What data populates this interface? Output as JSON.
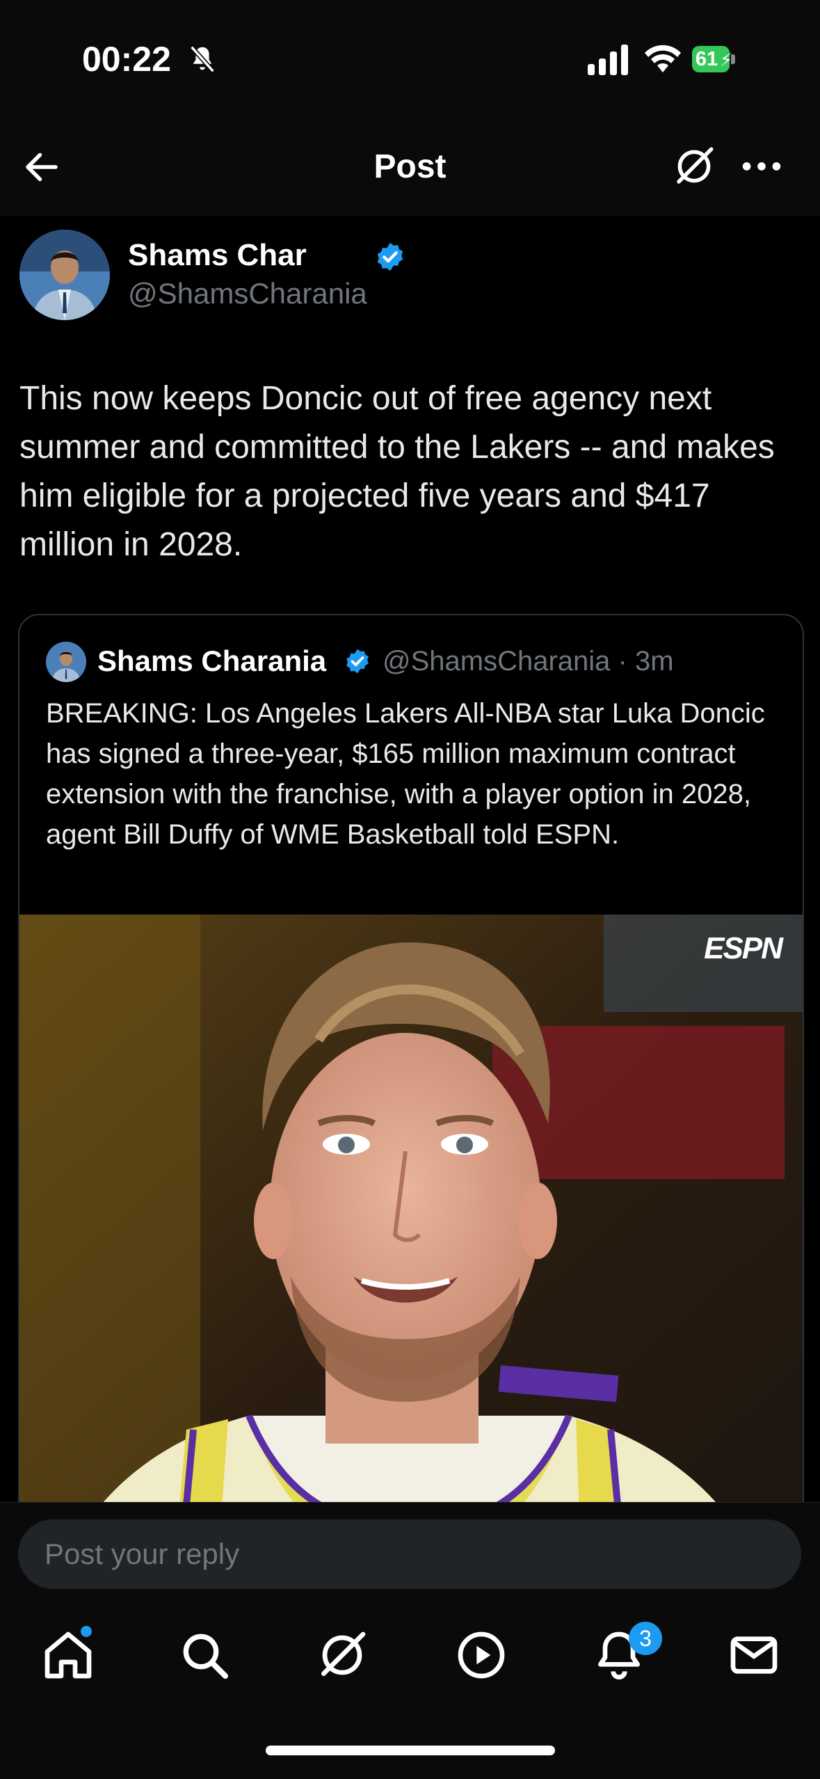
{
  "status": {
    "time": "00:22",
    "battery": "61"
  },
  "header": {
    "title": "Post"
  },
  "post": {
    "author_name": "Shams Char",
    "author_handle": "@ShamsCharania",
    "text": "This now keeps Doncic out of free agency next summer and committed to the Lakers -- and makes him eligible for a projected five years and $417 million in 2028."
  },
  "quote": {
    "author_name": "Shams Charania",
    "author_handle": "@ShamsCharania",
    "time": "3m",
    "text": "BREAKING: Los Angeles Lakers All-NBA star Luka Doncic has signed a three-year, $165 million maximum contract extension with the franchise, with a player option in 2028, agent Bill Duffy of WME Basketball told ESPN.",
    "image_watermark": "ESPN"
  },
  "reply": {
    "placeholder": "Post your reply"
  },
  "tabs": {
    "items": [
      "home-icon",
      "search-icon",
      "grok-icon",
      "video-icon",
      "notifications-icon",
      "messages-icon"
    ],
    "notifications_count": "3"
  },
  "colors": {
    "accent": "#1d9bf0",
    "battery": "#34c759",
    "background": "#000000"
  }
}
